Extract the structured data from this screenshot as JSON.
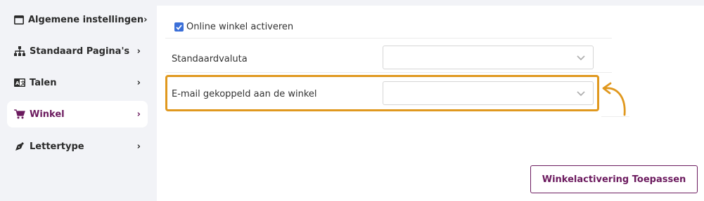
{
  "sidebar": {
    "items": [
      {
        "label": "Algemene instellingen",
        "icon": "window-icon"
      },
      {
        "label": "Standaard Pagina's",
        "icon": "sitemap-icon"
      },
      {
        "label": "Talen",
        "icon": "language-icon"
      },
      {
        "label": "Winkel",
        "icon": "cart-icon",
        "active": true
      },
      {
        "label": "Lettertype",
        "icon": "pen-nib-icon"
      }
    ]
  },
  "settings": {
    "enable_checkbox_label": "Online winkel activeren",
    "enable_checked": true,
    "currency_label": "Standaardvaluta",
    "currency_value": "",
    "email_label": "E-mail gekoppeld aan de winkel",
    "email_value": ""
  },
  "actions": {
    "apply_label": "Winkelactivering Toepassen"
  },
  "colors": {
    "accent": "#6b1a5e",
    "highlight": "#e0981e",
    "checkbox": "#3b6fd8",
    "sidebar_bg": "#f2f3f7"
  }
}
